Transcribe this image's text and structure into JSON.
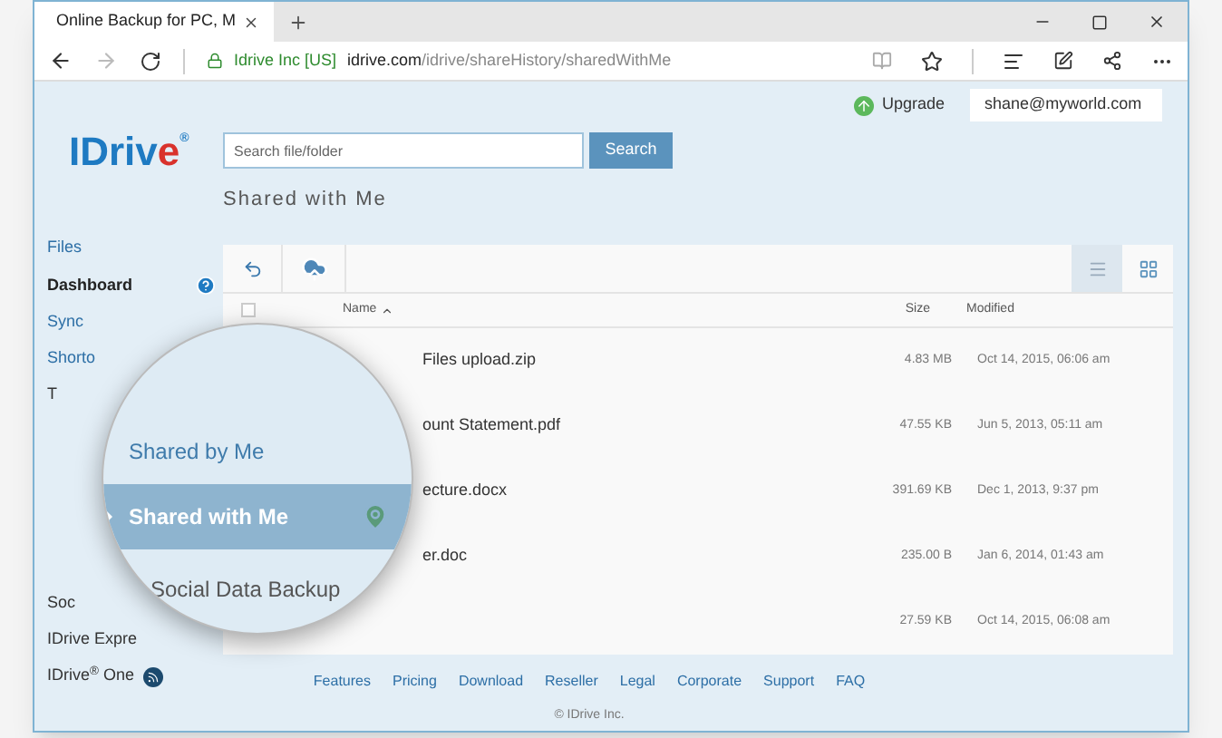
{
  "browser": {
    "tab_title": "Online Backup for PC, M",
    "site_identity": "Idrive Inc [US]",
    "url_domain": "idrive.com",
    "url_path": "/idrive/shareHistory/sharedWithMe"
  },
  "header": {
    "upgrade": "Upgrade",
    "account": "shane@myworld.com"
  },
  "logo": {
    "main": "IDriv",
    "accent": "e",
    "mark": "®"
  },
  "search": {
    "placeholder": "Search file/folder",
    "button": "Search"
  },
  "page_title": "Shared with Me",
  "sidebar": {
    "items": [
      {
        "label": "Files",
        "kind": "link"
      },
      {
        "label": "Dashboard",
        "kind": "section"
      },
      {
        "label": "Sync",
        "kind": "link"
      },
      {
        "label": "Shorto",
        "kind": "link"
      },
      {
        "label": "T",
        "kind": "link"
      },
      {
        "label": "Soc",
        "kind": "spacer_link"
      },
      {
        "label": "IDrive Expre",
        "kind": "link"
      },
      {
        "label": "IDrive$^{®}$ One",
        "kind": "rss"
      }
    ]
  },
  "magnifier": {
    "items": [
      {
        "label": "Shared by Me",
        "selected": false
      },
      {
        "label": "Shared with Me",
        "selected": true
      },
      {
        "label": "Social Data Backup",
        "selected": false
      }
    ]
  },
  "view_buttons": [
    {
      "kind": "list",
      "selected": true
    },
    {
      "kind": "grid",
      "selected": false
    }
  ],
  "table": {
    "select_all": {
      "checked": false
    },
    "columns": [
      "Name",
      "Size",
      "Modified"
    ],
    "rows": [
      {
        "name": "Files upload.zip",
        "size": "4.83 MB",
        "modified": "Oct 14, 2015, 06:06 am"
      },
      {
        "name": "ount Statement.pdf",
        "size": "47.55 KB",
        "modified": "Jun 5, 2013, 05:11 am"
      },
      {
        "name": "ecture.docx",
        "size": "391.69 KB",
        "modified": "Dec 1, 2013, 9:37 pm"
      },
      {
        "name": "er.doc",
        "size": "235.00 B",
        "modified": "Jan 6, 2014, 01:43 am"
      },
      {
        "size": "27.59 KB",
        "modified": "Oct 14, 2015, 06:08 am"
      }
    ]
  },
  "footer": {
    "links": [
      "Features",
      "Pricing",
      "Download",
      "Reseller",
      "Legal",
      "Corporate",
      "Support",
      "FAQ"
    ],
    "copyright": "© IDrive Inc."
  }
}
